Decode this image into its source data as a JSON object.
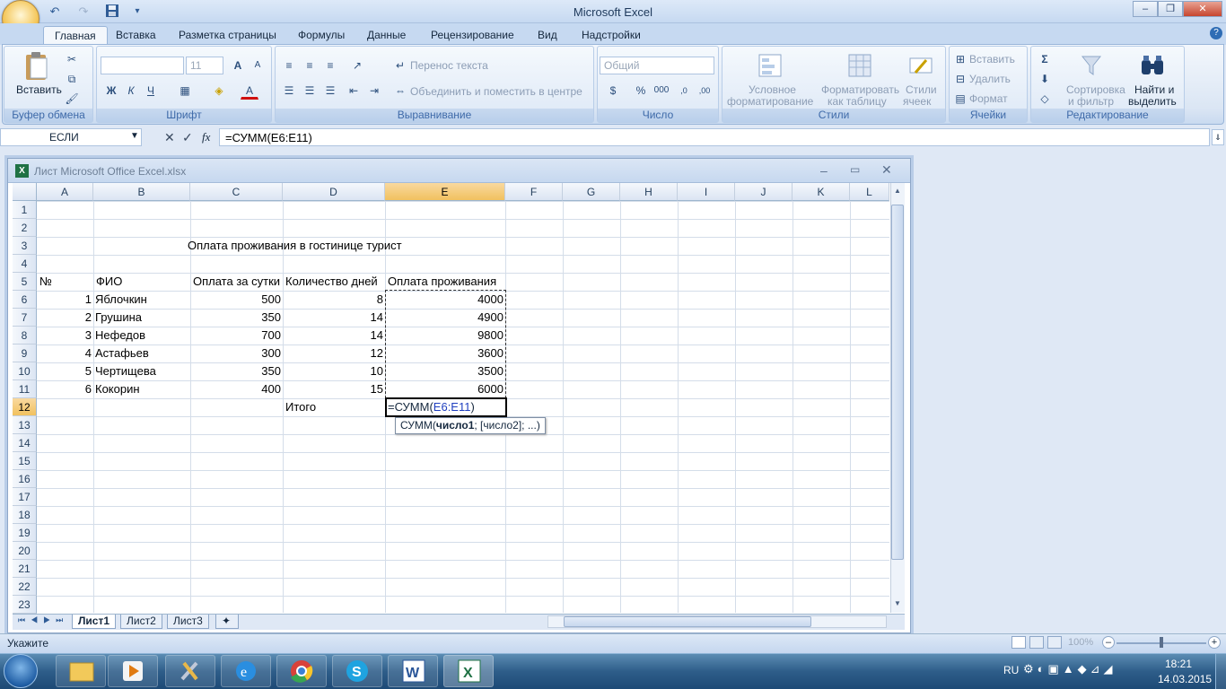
{
  "app": {
    "title": "Microsoft Excel"
  },
  "ribbon_tabs": [
    "Главная",
    "Вставка",
    "Разметка страницы",
    "Формулы",
    "Данные",
    "Рецензирование",
    "Вид",
    "Надстройки"
  ],
  "ribbon": {
    "clipboard": {
      "label": "Буфер обмена",
      "paste": "Вставить"
    },
    "font": {
      "label": "Шрифт",
      "size": "11"
    },
    "alignment": {
      "label": "Выравнивание",
      "wrap": "Перенос текста",
      "merge": "Объединить и поместить в центре"
    },
    "number": {
      "label": "Число",
      "format": "Общий"
    },
    "styles": {
      "label": "Стили",
      "cond1": "Условное",
      "cond2": "форматирование",
      "table1": "Форматировать",
      "table2": "как таблицу",
      "cell1": "Стили",
      "cell2": "ячеек"
    },
    "cells": {
      "label": "Ячейки",
      "insert": "Вставить",
      "delete": "Удалить",
      "format": "Формат"
    },
    "editing": {
      "label": "Редактирование",
      "sort1": "Сортировка",
      "sort2": "и фильтр",
      "find1": "Найти и",
      "find2": "выделить"
    }
  },
  "formula_bar": {
    "name_box": "ЕСЛИ",
    "fx": "fx",
    "formula": "=СУММ(E6:E11)"
  },
  "workbook": {
    "title": "Лист Microsoft Office Excel.xlsx"
  },
  "columns": [
    "A",
    "B",
    "C",
    "D",
    "E",
    "F",
    "G",
    "H",
    "I",
    "J",
    "K",
    "L"
  ],
  "rows": [
    "1",
    "2",
    "3",
    "4",
    "5",
    "6",
    "7",
    "8",
    "9",
    "10",
    "11",
    "12",
    "13",
    "14",
    "15",
    "16",
    "17",
    "18",
    "19",
    "20",
    "21",
    "22",
    "23"
  ],
  "sheet": {
    "title": "Оплата проживания в гостинице турист",
    "headers": {
      "no": "№",
      "fio": "ФИО",
      "rate": "Оплата за сутки",
      "days": "Количество дней",
      "total": "Оплата проживания"
    },
    "data": [
      {
        "no": "1",
        "fio": "Яблочкин",
        "rate": "500",
        "days": "8",
        "total": "4000"
      },
      {
        "no": "2",
        "fio": "Грушина",
        "rate": "350",
        "days": "14",
        "total": "4900"
      },
      {
        "no": "3",
        "fio": "Нефедов",
        "rate": "700",
        "days": "14",
        "total": "9800"
      },
      {
        "no": "4",
        "fio": "Астафьев",
        "rate": "300",
        "days": "12",
        "total": "3600"
      },
      {
        "no": "5",
        "fio": "Чертищева",
        "rate": "350",
        "days": "10",
        "total": "3500"
      },
      {
        "no": "6",
        "fio": "Кокорин",
        "rate": "400",
        "days": "15",
        "total": "6000"
      }
    ],
    "itogo": "Итого",
    "edit_prefix": "=СУММ(",
    "edit_ref": "E6:E11",
    "edit_suffix": ")",
    "tooltip_fn": "СУММ(",
    "tooltip_arg1": "число1",
    "tooltip_rest": "; [число2]; ...)"
  },
  "sheet_tabs": [
    "Лист1",
    "Лист2",
    "Лист3"
  ],
  "status": {
    "mode": "Укажите",
    "zoom": "100%"
  },
  "tray": {
    "lang": "RU",
    "time": "18:21",
    "date": "14.03.2015"
  }
}
